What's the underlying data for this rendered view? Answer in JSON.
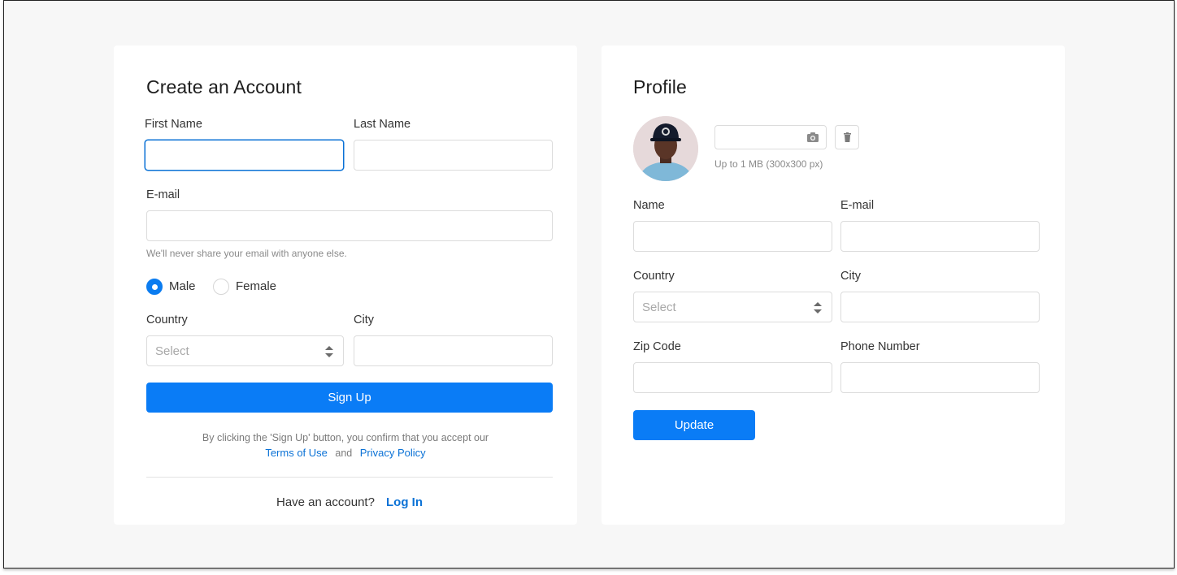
{
  "signup": {
    "title": "Create an Account",
    "first_name_label": "First Name",
    "last_name_label": "Last Name",
    "email_label": "E-mail",
    "email_hint": "We'll never share your email with anyone else.",
    "gender_options": [
      "Male",
      "Female"
    ],
    "gender_selected": "Male",
    "country_label": "Country",
    "country_placeholder": "Select",
    "city_label": "City",
    "submit_label": "Sign Up",
    "legal_text": "By clicking the 'Sign Up' button, you confirm that you accept our",
    "terms_link": "Terms of Use",
    "and_text": "and",
    "privacy_link": "Privacy Policy",
    "have_account_text": "Have an account?",
    "login_link": "Log In"
  },
  "profile": {
    "title": "Profile",
    "avatar_icon": "user-photo",
    "upload_icon": "camera-icon",
    "delete_icon": "trash-icon",
    "upload_hint": "Up to 1 MB (300x300 px)",
    "name_label": "Name",
    "email_label": "E-mail",
    "country_label": "Country",
    "country_placeholder": "Select",
    "city_label": "City",
    "zip_label": "Zip Code",
    "phone_label": "Phone Number",
    "submit_label": "Update"
  },
  "colors": {
    "accent": "#0a7cf6",
    "background": "#f7f7f7",
    "card": "#ffffff"
  }
}
